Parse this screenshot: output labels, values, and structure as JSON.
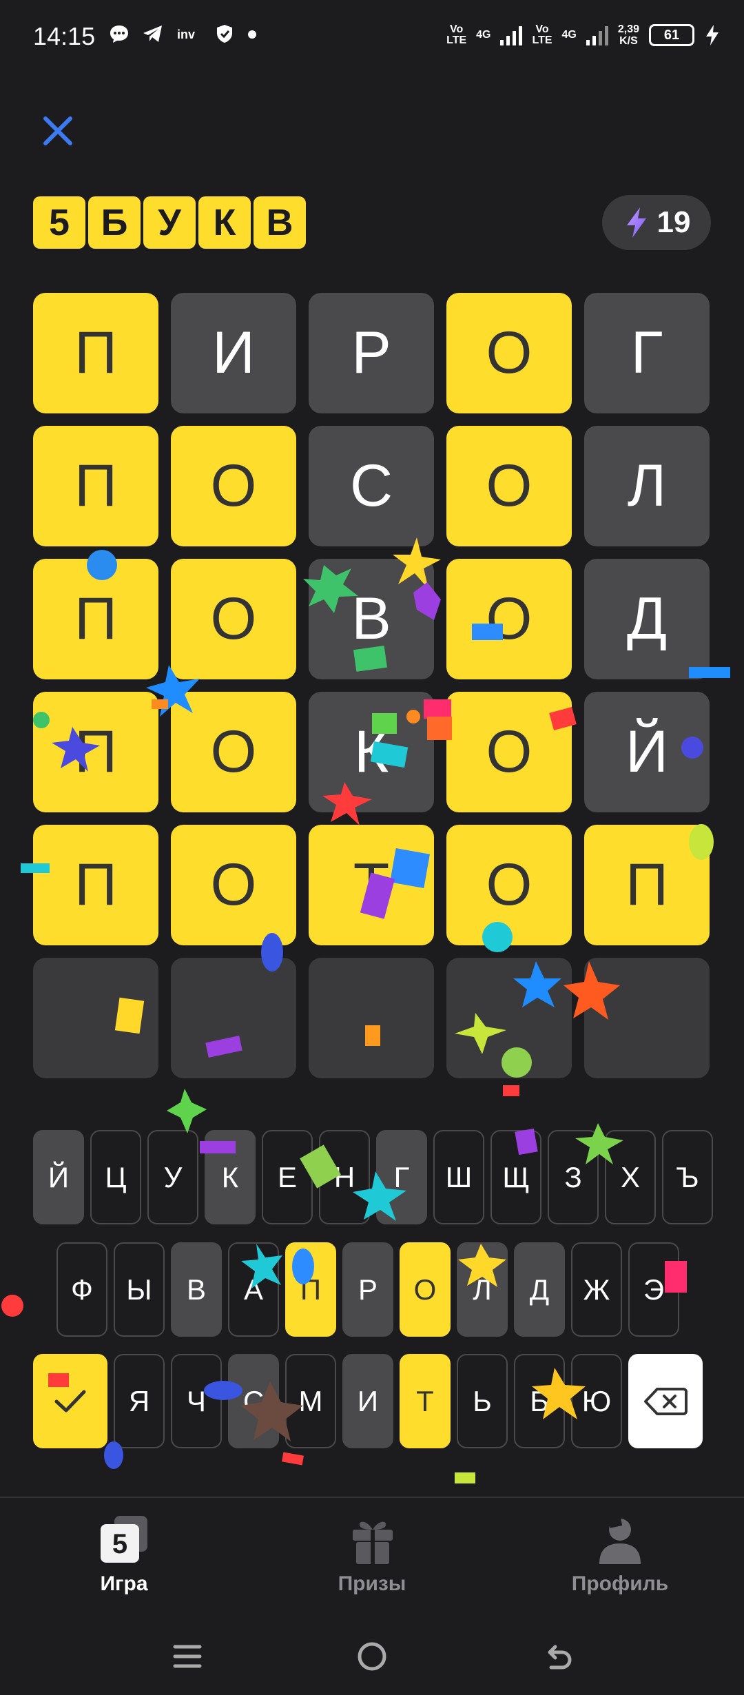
{
  "status_bar": {
    "time": "14:15",
    "net1": {
      "top": "Vo",
      "bottom": "LTE"
    },
    "net1_gen": "4G",
    "net2": {
      "top": "Vo",
      "bottom": "LTE"
    },
    "net2_gen": "4G",
    "speed": {
      "value": "2,39",
      "unit": "K/S"
    },
    "battery": "61"
  },
  "header": {
    "logo_letters": [
      "5",
      "Б",
      "У",
      "К",
      "В"
    ],
    "energy_count": "19"
  },
  "board": {
    "rows": [
      [
        {
          "letter": "П",
          "state": "yellow"
        },
        {
          "letter": "И",
          "state": "gray"
        },
        {
          "letter": "Р",
          "state": "gray"
        },
        {
          "letter": "О",
          "state": "yellow"
        },
        {
          "letter": "Г",
          "state": "gray"
        }
      ],
      [
        {
          "letter": "П",
          "state": "yellow"
        },
        {
          "letter": "О",
          "state": "yellow"
        },
        {
          "letter": "С",
          "state": "gray"
        },
        {
          "letter": "О",
          "state": "yellow"
        },
        {
          "letter": "Л",
          "state": "gray"
        }
      ],
      [
        {
          "letter": "П",
          "state": "yellow"
        },
        {
          "letter": "О",
          "state": "yellow"
        },
        {
          "letter": "В",
          "state": "gray"
        },
        {
          "letter": "О",
          "state": "yellow"
        },
        {
          "letter": "Д",
          "state": "gray"
        }
      ],
      [
        {
          "letter": "П",
          "state": "yellow"
        },
        {
          "letter": "О",
          "state": "yellow"
        },
        {
          "letter": "К",
          "state": "gray"
        },
        {
          "letter": "О",
          "state": "yellow"
        },
        {
          "letter": "Й",
          "state": "gray"
        }
      ],
      [
        {
          "letter": "П",
          "state": "yellow"
        },
        {
          "letter": "О",
          "state": "yellow"
        },
        {
          "letter": "Т",
          "state": "yellow"
        },
        {
          "letter": "О",
          "state": "yellow"
        },
        {
          "letter": "П",
          "state": "yellow"
        }
      ],
      [
        {
          "letter": "",
          "state": "empty"
        },
        {
          "letter": "",
          "state": "empty"
        },
        {
          "letter": "",
          "state": "empty"
        },
        {
          "letter": "",
          "state": "empty"
        },
        {
          "letter": "",
          "state": "empty"
        }
      ]
    ]
  },
  "keyboard": {
    "row1": [
      {
        "key": "Й",
        "state": "used"
      },
      {
        "key": "Ц",
        "state": "unused"
      },
      {
        "key": "У",
        "state": "unused"
      },
      {
        "key": "К",
        "state": "used"
      },
      {
        "key": "Е",
        "state": "unused"
      },
      {
        "key": "Н",
        "state": "unused"
      },
      {
        "key": "Г",
        "state": "used"
      },
      {
        "key": "Ш",
        "state": "unused"
      },
      {
        "key": "Щ",
        "state": "unused"
      },
      {
        "key": "З",
        "state": "unused"
      },
      {
        "key": "Х",
        "state": "unused"
      },
      {
        "key": "Ъ",
        "state": "unused"
      }
    ],
    "row2": [
      {
        "key": "Ф",
        "state": "unused"
      },
      {
        "key": "Ы",
        "state": "unused"
      },
      {
        "key": "В",
        "state": "used"
      },
      {
        "key": "А",
        "state": "unused"
      },
      {
        "key": "П",
        "state": "hit"
      },
      {
        "key": "Р",
        "state": "used"
      },
      {
        "key": "О",
        "state": "hit"
      },
      {
        "key": "Л",
        "state": "used"
      },
      {
        "key": "Д",
        "state": "used"
      },
      {
        "key": "Ж",
        "state": "unused"
      },
      {
        "key": "Э",
        "state": "unused"
      }
    ],
    "row3": [
      {
        "key": "Я",
        "state": "unused"
      },
      {
        "key": "Ч",
        "state": "unused"
      },
      {
        "key": "С",
        "state": "used"
      },
      {
        "key": "М",
        "state": "unused"
      },
      {
        "key": "И",
        "state": "used"
      },
      {
        "key": "Т",
        "state": "hit"
      },
      {
        "key": "Ь",
        "state": "unused"
      },
      {
        "key": "Б",
        "state": "unused"
      },
      {
        "key": "Ю",
        "state": "unused"
      }
    ],
    "enter_icon": "checkmark-icon",
    "backspace_icon": "backspace-icon"
  },
  "bottom_nav": {
    "items": [
      {
        "label": "Игра",
        "icon": "game-icon",
        "active": true
      },
      {
        "label": "Призы",
        "icon": "gift-icon",
        "active": false
      },
      {
        "label": "Профиль",
        "icon": "profile-icon",
        "active": false
      }
    ],
    "game_icon_text": "5"
  },
  "colors": {
    "accent_yellow": "#ffdd2d",
    "absent_gray": "#4a4a4c",
    "empty_cell": "#3a3a3c",
    "background": "#1c1c1e",
    "close_blue": "#3d7bf5"
  }
}
